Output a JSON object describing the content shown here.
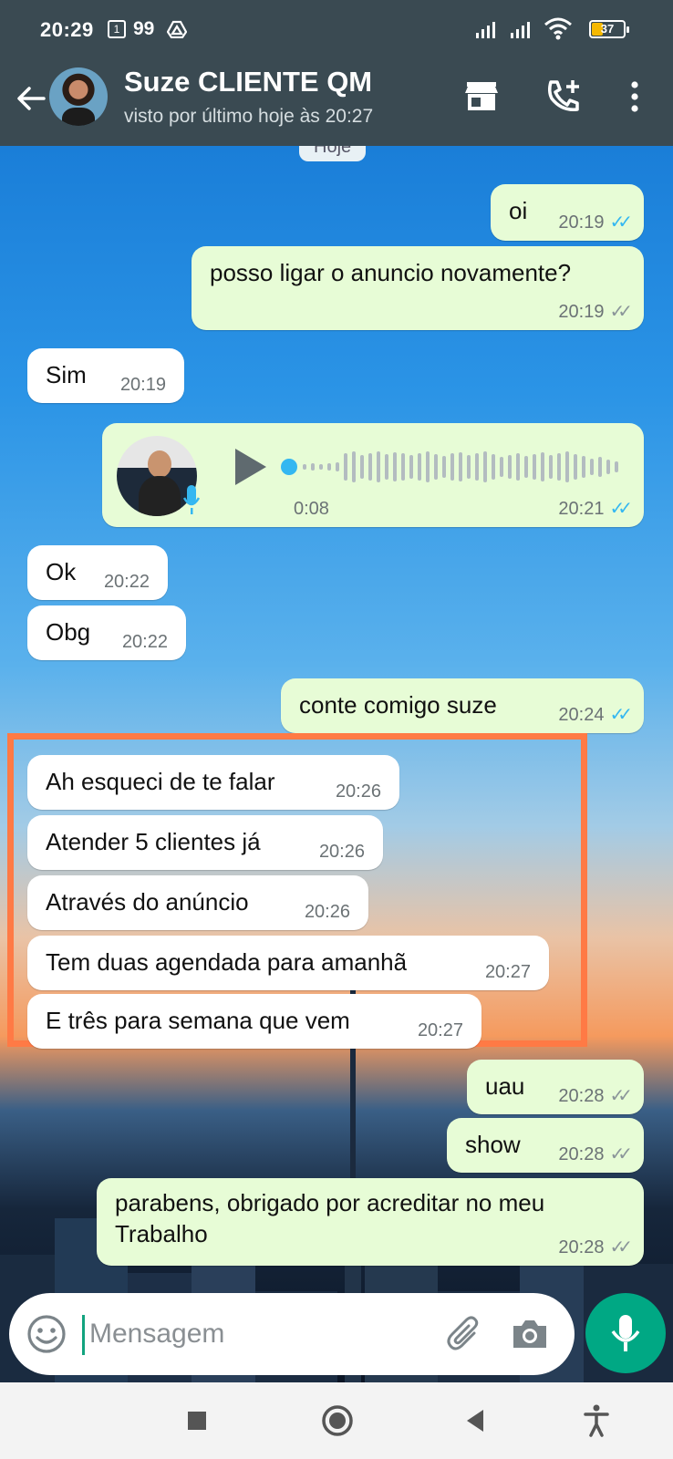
{
  "status_bar": {
    "time": "20:29",
    "sim_label": "1",
    "notification_count": "99",
    "battery_percent": "37"
  },
  "header": {
    "contact_name": "Suze CLIENTE QM",
    "last_seen": "visto por último hoje às 20:27",
    "icons": [
      "back-arrow-icon",
      "store-icon",
      "add-call-icon",
      "more-vert-icon"
    ]
  },
  "chat": {
    "date_chip": "Hoje",
    "messages": [
      {
        "direction": "out",
        "text": "oi",
        "time": "20:19",
        "status": "read"
      },
      {
        "direction": "out",
        "text": "posso ligar o anuncio novamente?",
        "time": "20:19",
        "status": "delivered"
      },
      {
        "direction": "in",
        "text": "Sim",
        "time": "20:19"
      },
      {
        "direction": "out",
        "type": "voice",
        "duration": "0:08",
        "time": "20:21",
        "status": "read"
      },
      {
        "direction": "in",
        "text": "Ok",
        "time": "20:22"
      },
      {
        "direction": "in",
        "text": "Obg",
        "time": "20:22"
      },
      {
        "direction": "out",
        "text": "conte comigo suze",
        "time": "20:24",
        "status": "read"
      },
      {
        "direction": "in",
        "text": "Ah esqueci de te falar",
        "time": "20:26"
      },
      {
        "direction": "in",
        "text": "Atender 5 clientes já",
        "time": "20:26"
      },
      {
        "direction": "in",
        "text": "Através do anúncio",
        "time": "20:26"
      },
      {
        "direction": "in",
        "text": "Tem duas agendada para amanhã",
        "time": "20:27"
      },
      {
        "direction": "in",
        "text": "E três para semana que vem",
        "time": "20:27"
      },
      {
        "direction": "out",
        "text": "uau",
        "time": "20:28",
        "status": "delivered"
      },
      {
        "direction": "out",
        "text": "show",
        "time": "20:28",
        "status": "delivered"
      },
      {
        "direction": "out",
        "text": "parabens, obrigado por acreditar no meu\nTrabalho",
        "time": "20:28",
        "status": "delivered"
      }
    ]
  },
  "composer": {
    "placeholder": "Mensagem",
    "value": ""
  },
  "colors": {
    "header_bg": "#3a4a52",
    "incoming_bubble": "#ffffff",
    "outgoing_bubble": "#e7fcd6",
    "read_ticks": "#34b7f1",
    "mic_button": "#00a884",
    "highlight_border": "#ff7a45"
  }
}
